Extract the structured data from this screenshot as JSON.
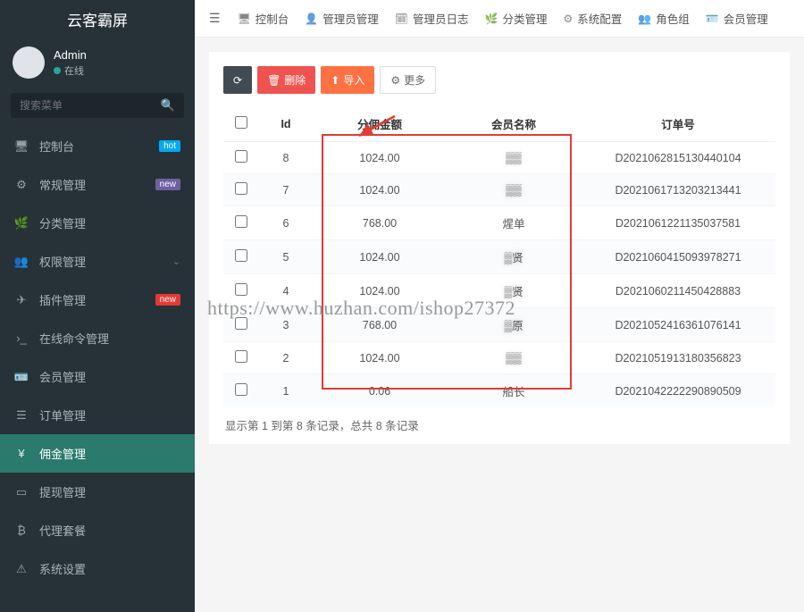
{
  "app_title": "云客霸屏",
  "user": {
    "name": "Admin",
    "status": "在线"
  },
  "search_placeholder": "搜索菜单",
  "topnav": [
    {
      "label": "控制台",
      "icon": "🖥"
    },
    {
      "label": "管理员管理",
      "icon": "👤"
    },
    {
      "label": "管理员日志",
      "icon": "🗓"
    },
    {
      "label": "分类管理",
      "icon": "🌿"
    },
    {
      "label": "系统配置",
      "icon": "⚙"
    },
    {
      "label": "角色组",
      "icon": "👥"
    },
    {
      "label": "会员管理",
      "icon": "🪪"
    }
  ],
  "sidenav": [
    {
      "label": "控制台",
      "icon": "🖥",
      "badge": "hot",
      "badge_class": "badge-hot"
    },
    {
      "label": "常规管理",
      "icon": "⚙",
      "badge": "new",
      "badge_class": "badge-new"
    },
    {
      "label": "分类管理",
      "icon": "🌿"
    },
    {
      "label": "权限管理",
      "icon": "👥",
      "chev": true
    },
    {
      "label": "插件管理",
      "icon": "✈",
      "badge": "new",
      "badge_class": "badge-new2"
    },
    {
      "label": "在线命令管理",
      "icon": "›_"
    },
    {
      "label": "会员管理",
      "icon": "🪪"
    },
    {
      "label": "订单管理",
      "icon": "☰"
    },
    {
      "label": "佣金管理",
      "icon": "¥",
      "active": true
    },
    {
      "label": "提现管理",
      "icon": "▭"
    },
    {
      "label": "代理套餐",
      "icon": "₿"
    },
    {
      "label": "系统设置",
      "icon": "⚠"
    }
  ],
  "toolbar": {
    "refresh": "",
    "delete": "删除",
    "import": "导入",
    "more": "更多"
  },
  "table": {
    "headers": [
      "",
      "Id",
      "分佣金额",
      "会员名称",
      "订单号"
    ],
    "rows": [
      {
        "id": "8",
        "amount": "1024.00",
        "member": "▒▒",
        "order": "D2021062815130440104"
      },
      {
        "id": "7",
        "amount": "1024.00",
        "member": "▒▒",
        "order": "D2021061713203213441"
      },
      {
        "id": "6",
        "amount": "768.00",
        "member": "煋单",
        "order": "D2021061221135037581"
      },
      {
        "id": "5",
        "amount": "1024.00",
        "member": "▒贤",
        "order": "D2021060415093978271"
      },
      {
        "id": "4",
        "amount": "1024.00",
        "member": "▒贤",
        "order": "D2021060211450428883"
      },
      {
        "id": "3",
        "amount": "768.00",
        "member": "▒原",
        "order": "D2021052416361076141"
      },
      {
        "id": "2",
        "amount": "1024.00",
        "member": "▒▒",
        "order": "D2021051913180356823"
      },
      {
        "id": "1",
        "amount": "0.06",
        "member": "船长",
        "order": "D2021042222290890509"
      }
    ]
  },
  "pager_info": "显示第 1 到第 8 条记录，总共 8 条记录",
  "watermark_text": "https://www.huzhan.com/ishop27372"
}
